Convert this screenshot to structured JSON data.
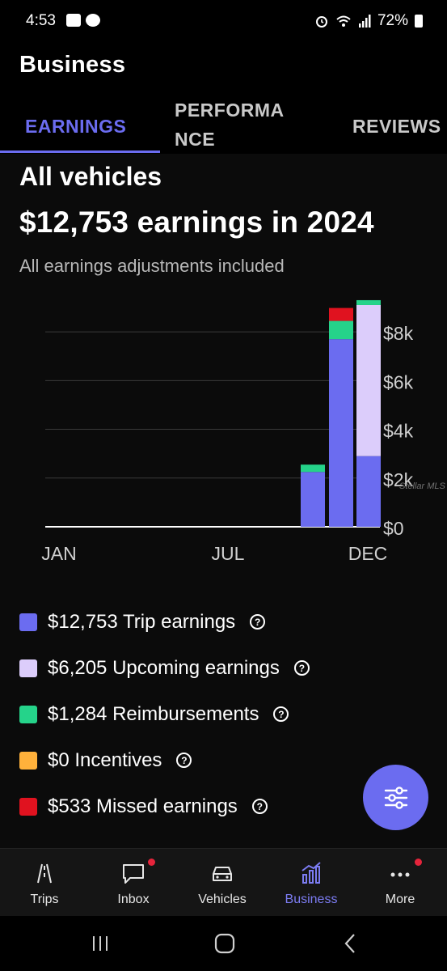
{
  "status_bar": {
    "time": "4:53",
    "battery": "72%"
  },
  "header": {
    "title": "Business"
  },
  "tabs": [
    {
      "label": "EARNINGS"
    },
    {
      "label": "PERFORMANCE",
      "line1": "PERFORMA",
      "line2": "NCE"
    },
    {
      "label": "REVIEWS"
    }
  ],
  "summary": {
    "scope": "All vehicles",
    "headline": "$12,753 earnings in 2024",
    "subtitle": "All earnings adjustments included"
  },
  "chart_data": {
    "type": "bar",
    "stacked": true,
    "x_tick_labels": [
      "JAN",
      "JUL",
      "DEC"
    ],
    "y_tick_labels": [
      "$0",
      "$2k",
      "$4k",
      "$6k",
      "$8k"
    ],
    "ylim": [
      0,
      9000
    ],
    "grid": true,
    "categories": [
      "OCT",
      "NOV",
      "DEC"
    ],
    "series": [
      {
        "name": "Trip earnings",
        "color": "#6b6cf0",
        "values": [
          2250,
          7700,
          2900
        ]
      },
      {
        "name": "Upcoming earnings",
        "color": "#dccdfb",
        "values": [
          0,
          0,
          6200
        ]
      },
      {
        "name": "Reimbursements",
        "color": "#25d38a",
        "values": [
          300,
          750,
          200
        ]
      },
      {
        "name": "Incentives",
        "color": "#ffb13b",
        "values": [
          0,
          0,
          0
        ]
      },
      {
        "name": "Missed earnings",
        "color": "#e0121f",
        "values": [
          0,
          530,
          0
        ]
      }
    ],
    "watermark": "Stellar MLS"
  },
  "legend": [
    {
      "label": "$12,753 Trip earnings",
      "color": "#6b6cf0"
    },
    {
      "label": "$6,205 Upcoming earnings",
      "color": "#dccdfb"
    },
    {
      "label": "$1,284 Reimbursements",
      "color": "#25d38a"
    },
    {
      "label": "$0 Incentives",
      "color": "#ffb13b"
    },
    {
      "label": "$533 Missed earnings",
      "color": "#e0121f"
    }
  ],
  "help_glyph": "?",
  "nav": [
    {
      "label": "Trips",
      "icon": "road-icon"
    },
    {
      "label": "Inbox",
      "icon": "chat-bubble-icon"
    },
    {
      "label": "Vehicles",
      "icon": "car-icon"
    },
    {
      "label": "Business",
      "icon": "bar-chart-icon"
    },
    {
      "label": "More",
      "icon": "more-dots-icon"
    }
  ],
  "accent_color": "#6b6cf0"
}
